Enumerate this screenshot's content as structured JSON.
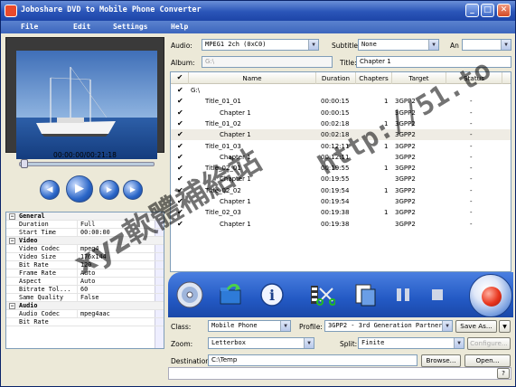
{
  "window": {
    "title": "Joboshare DVD to Mobile Phone Converter",
    "buttons": [
      "_",
      "□",
      "✕"
    ]
  },
  "menu": [
    "File",
    "Edit",
    "Settings",
    "Help"
  ],
  "player": {
    "time": "00:00:00/00:21:18",
    "progress_fraction": 0.0
  },
  "properties": [
    {
      "type": "section",
      "label": "General",
      "toggle": "−"
    },
    {
      "key": "Duration",
      "value": "Full"
    },
    {
      "key": "Start Time",
      "value": "00:00:00"
    },
    {
      "type": "section",
      "label": "Video",
      "toggle": "−"
    },
    {
      "key": "Video Codec",
      "value": "mpeg4"
    },
    {
      "key": "Video Size",
      "value": "176x144"
    },
    {
      "key": "Bit Rate",
      "value": "120"
    },
    {
      "key": "Frame Rate",
      "value": "Auto"
    },
    {
      "key": "Aspect",
      "value": "Auto"
    },
    {
      "key": "Bitrate Tol...",
      "value": "60"
    },
    {
      "key": "Same Quality",
      "value": "False"
    },
    {
      "type": "section",
      "label": "Audio",
      "toggle": "−"
    },
    {
      "key": "Audio Codec",
      "value": "mpeg4aac"
    },
    {
      "key": "Bit Rate",
      "value": ""
    }
  ],
  "top": {
    "audio_label": "Audio:",
    "audio_value": "MPEG1 2ch (0xC0)",
    "subtitle_label": "Subtitle:",
    "subtitle_value": "None",
    "angle_label": "An",
    "album_label": "Album:",
    "album_value": "G:\\",
    "title_label": "Title:",
    "title_value": "Chapter 1"
  },
  "list": {
    "columns": [
      "Name",
      "Duration",
      "Chapters",
      "Target",
      "Status"
    ],
    "rows": [
      {
        "indent": 0,
        "name": "G:\\",
        "duration": "",
        "chapters": "",
        "target": "",
        "status": ""
      },
      {
        "indent": 1,
        "name": "Title_01_01",
        "duration": "00:00:15",
        "chapters": "1",
        "target": "3GPP2",
        "status": "-"
      },
      {
        "indent": 2,
        "name": "Chapter 1",
        "duration": "00:00:15",
        "chapters": "",
        "target": "3GPP2",
        "status": "-"
      },
      {
        "indent": 1,
        "name": "Title_01_02",
        "duration": "00:02:18",
        "chapters": "1",
        "target": "3GPP2",
        "status": "-"
      },
      {
        "indent": 2,
        "name": "Chapter 1",
        "duration": "00:02:18",
        "chapters": "",
        "target": "3GPP2",
        "status": "-",
        "selected": true
      },
      {
        "indent": 1,
        "name": "Title_01_03",
        "duration": "00:12:11",
        "chapters": "1",
        "target": "3GPP2",
        "status": "-"
      },
      {
        "indent": 2,
        "name": "Chapter 1",
        "duration": "00:12:11",
        "chapters": "",
        "target": "3GPP2",
        "status": "-"
      },
      {
        "indent": 1,
        "name": "Title_02_01",
        "duration": "00:19:55",
        "chapters": "1",
        "target": "3GPP2",
        "status": "-"
      },
      {
        "indent": 2,
        "name": "Chapter 1",
        "duration": "00:19:55",
        "chapters": "",
        "target": "3GPP2",
        "status": "-"
      },
      {
        "indent": 1,
        "name": "Title_02_02",
        "duration": "00:19:54",
        "chapters": "1",
        "target": "3GPP2",
        "status": "-"
      },
      {
        "indent": 2,
        "name": "Chapter 1",
        "duration": "00:19:54",
        "chapters": "",
        "target": "3GPP2",
        "status": "-"
      },
      {
        "indent": 1,
        "name": "Title_02_03",
        "duration": "00:19:38",
        "chapters": "1",
        "target": "3GPP2",
        "status": "-"
      },
      {
        "indent": 2,
        "name": "Chapter 1",
        "duration": "00:19:38",
        "chapters": "",
        "target": "3GPP2",
        "status": "-"
      }
    ]
  },
  "toolbar": {
    "icons": [
      "open-dvd-icon",
      "load-folder-icon",
      "info-icon",
      "trim-icon",
      "snapshot-icon",
      "pause-icon",
      "stop-icon",
      "convert-icon"
    ]
  },
  "bottom": {
    "class_label": "Class:",
    "class_value": "Mobile Phone",
    "profile_label": "Profile:",
    "profile_value": "3GPP2 - 3rd Generation Partnership",
    "save_as": "Save As...",
    "zoom_label": "Zoom:",
    "zoom_value": "Letterbox",
    "split_label": "Split:",
    "split_value": "Finite",
    "configure": "Configure...",
    "destination_label": "Destination:",
    "destination_value": "C:\\Temp",
    "browse": "Browse...",
    "open": "Open...",
    "help": "?"
  },
  "watermark": {
    "main": "xyz軟體補給站",
    "url": "http://51.to"
  }
}
